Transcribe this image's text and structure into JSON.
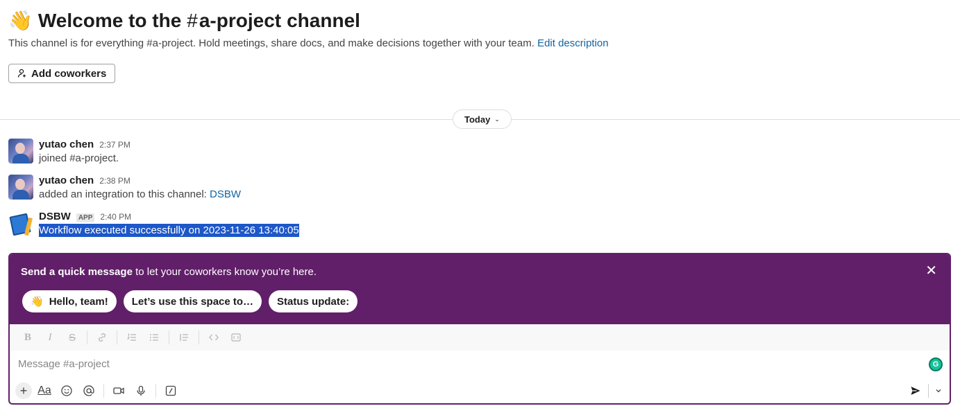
{
  "header": {
    "wave_emoji": "👋",
    "title_prefix": "Welcome to the",
    "channel_hash": "#",
    "channel_name": "a-project",
    "title_suffix": "channel",
    "description": "This channel is for everything #a-project. Hold meetings, share docs, and make decisions together with your team.",
    "edit_link": "Edit description"
  },
  "add_coworkers_label": "Add coworkers",
  "date_divider": "Today",
  "messages": [
    {
      "author": "yutao chen",
      "time": "2:37 PM",
      "text": "joined #a-project."
    },
    {
      "author": "yutao chen",
      "time": "2:38 PM",
      "text": "added an integration to this channel: ",
      "link": "DSBW"
    },
    {
      "author": "DSBW",
      "badge": "APP",
      "time": "2:40 PM",
      "text": "Workflow executed successfully on 2023-11-26 13:40:05"
    }
  ],
  "promo": {
    "bold": "Send a quick message",
    "rest": " to let your coworkers know you’re here.",
    "chips": [
      {
        "emoji": "👋",
        "label": "Hello, team!"
      },
      {
        "label": "Let’s use this space to…"
      },
      {
        "label": "Status update:"
      }
    ]
  },
  "composer": {
    "placeholder": "Message #a-project",
    "grammarly_letter": "G"
  },
  "colors": {
    "promo_bg": "#611f69",
    "link": "#1264a3",
    "selection": "#1d57c8"
  }
}
